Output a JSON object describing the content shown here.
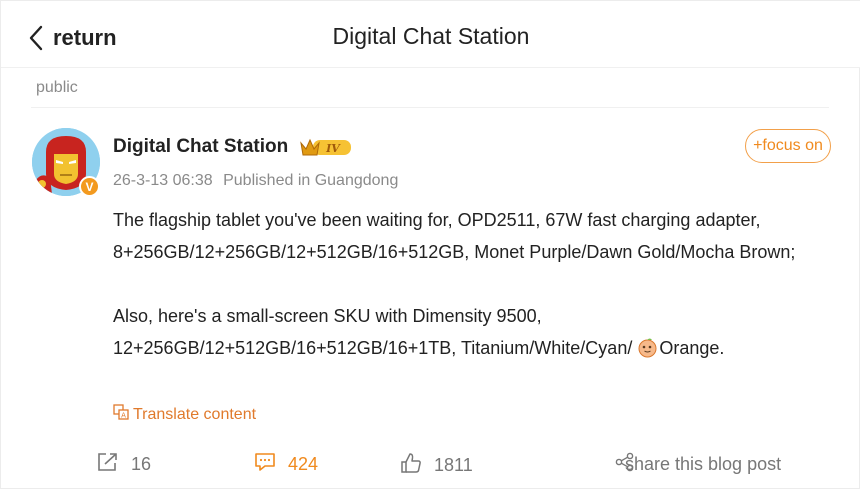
{
  "header": {
    "back_label": "return",
    "title": "Digital Chat Station"
  },
  "visibility": "public",
  "post": {
    "author": "Digital Chat Station",
    "level_badge": "IV",
    "verified_mark": "V",
    "timestamp": "26-3-13 06:38",
    "location": "Published in Guangdong",
    "focus_label": "+focus on",
    "paragraph_1": "The flagship tablet you've been waiting for, OPD2511, 67W fast charging adapter, 8+256GB/12+256GB/12+512GB/16+512GB, Monet Purple/Dawn Gold/Mocha Brown;",
    "paragraph_2_start": "Also, here's a small-screen SKU with Dimensity 9500, 12+256GB/12+512GB/16+512GB/16+1TB, Titanium/White/Cyan/",
    "paragraph_2_end": "Orange.",
    "translate_label": "Translate content"
  },
  "actions": {
    "forward_count": "16",
    "comment_count": "424",
    "like_count": "1811",
    "share_label": "share this blog post"
  },
  "icons": {
    "back": "chevron-left-icon",
    "verified": "verified-badge-icon",
    "crown": "crown-icon",
    "emoji": "orange-fruit-emoji-icon",
    "translate": "translate-icon",
    "forward": "forward-icon",
    "comment": "comment-icon",
    "like": "thumbs-up-icon",
    "share": "share-icon"
  },
  "colors": {
    "accent": "#f08a1e",
    "muted": "#8a8a8a",
    "text": "#222222"
  }
}
